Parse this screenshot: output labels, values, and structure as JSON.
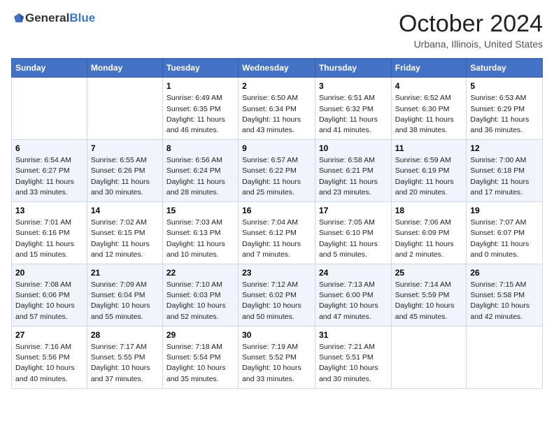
{
  "header": {
    "logo_general": "General",
    "logo_blue": "Blue",
    "month_title": "October 2024",
    "location": "Urbana, Illinois, United States"
  },
  "weekdays": [
    "Sunday",
    "Monday",
    "Tuesday",
    "Wednesday",
    "Thursday",
    "Friday",
    "Saturday"
  ],
  "weeks": [
    [
      {
        "day": "",
        "content": ""
      },
      {
        "day": "",
        "content": ""
      },
      {
        "day": "1",
        "content": "Sunrise: 6:49 AM\nSunset: 6:35 PM\nDaylight: 11 hours and 46 minutes."
      },
      {
        "day": "2",
        "content": "Sunrise: 6:50 AM\nSunset: 6:34 PM\nDaylight: 11 hours and 43 minutes."
      },
      {
        "day": "3",
        "content": "Sunrise: 6:51 AM\nSunset: 6:32 PM\nDaylight: 11 hours and 41 minutes."
      },
      {
        "day": "4",
        "content": "Sunrise: 6:52 AM\nSunset: 6:30 PM\nDaylight: 11 hours and 38 minutes."
      },
      {
        "day": "5",
        "content": "Sunrise: 6:53 AM\nSunset: 6:29 PM\nDaylight: 11 hours and 36 minutes."
      }
    ],
    [
      {
        "day": "6",
        "content": "Sunrise: 6:54 AM\nSunset: 6:27 PM\nDaylight: 11 hours and 33 minutes."
      },
      {
        "day": "7",
        "content": "Sunrise: 6:55 AM\nSunset: 6:26 PM\nDaylight: 11 hours and 30 minutes."
      },
      {
        "day": "8",
        "content": "Sunrise: 6:56 AM\nSunset: 6:24 PM\nDaylight: 11 hours and 28 minutes."
      },
      {
        "day": "9",
        "content": "Sunrise: 6:57 AM\nSunset: 6:22 PM\nDaylight: 11 hours and 25 minutes."
      },
      {
        "day": "10",
        "content": "Sunrise: 6:58 AM\nSunset: 6:21 PM\nDaylight: 11 hours and 23 minutes."
      },
      {
        "day": "11",
        "content": "Sunrise: 6:59 AM\nSunset: 6:19 PM\nDaylight: 11 hours and 20 minutes."
      },
      {
        "day": "12",
        "content": "Sunrise: 7:00 AM\nSunset: 6:18 PM\nDaylight: 11 hours and 17 minutes."
      }
    ],
    [
      {
        "day": "13",
        "content": "Sunrise: 7:01 AM\nSunset: 6:16 PM\nDaylight: 11 hours and 15 minutes."
      },
      {
        "day": "14",
        "content": "Sunrise: 7:02 AM\nSunset: 6:15 PM\nDaylight: 11 hours and 12 minutes."
      },
      {
        "day": "15",
        "content": "Sunrise: 7:03 AM\nSunset: 6:13 PM\nDaylight: 11 hours and 10 minutes."
      },
      {
        "day": "16",
        "content": "Sunrise: 7:04 AM\nSunset: 6:12 PM\nDaylight: 11 hours and 7 minutes."
      },
      {
        "day": "17",
        "content": "Sunrise: 7:05 AM\nSunset: 6:10 PM\nDaylight: 11 hours and 5 minutes."
      },
      {
        "day": "18",
        "content": "Sunrise: 7:06 AM\nSunset: 6:09 PM\nDaylight: 11 hours and 2 minutes."
      },
      {
        "day": "19",
        "content": "Sunrise: 7:07 AM\nSunset: 6:07 PM\nDaylight: 11 hours and 0 minutes."
      }
    ],
    [
      {
        "day": "20",
        "content": "Sunrise: 7:08 AM\nSunset: 6:06 PM\nDaylight: 10 hours and 57 minutes."
      },
      {
        "day": "21",
        "content": "Sunrise: 7:09 AM\nSunset: 6:04 PM\nDaylight: 10 hours and 55 minutes."
      },
      {
        "day": "22",
        "content": "Sunrise: 7:10 AM\nSunset: 6:03 PM\nDaylight: 10 hours and 52 minutes."
      },
      {
        "day": "23",
        "content": "Sunrise: 7:12 AM\nSunset: 6:02 PM\nDaylight: 10 hours and 50 minutes."
      },
      {
        "day": "24",
        "content": "Sunrise: 7:13 AM\nSunset: 6:00 PM\nDaylight: 10 hours and 47 minutes."
      },
      {
        "day": "25",
        "content": "Sunrise: 7:14 AM\nSunset: 5:59 PM\nDaylight: 10 hours and 45 minutes."
      },
      {
        "day": "26",
        "content": "Sunrise: 7:15 AM\nSunset: 5:58 PM\nDaylight: 10 hours and 42 minutes."
      }
    ],
    [
      {
        "day": "27",
        "content": "Sunrise: 7:16 AM\nSunset: 5:56 PM\nDaylight: 10 hours and 40 minutes."
      },
      {
        "day": "28",
        "content": "Sunrise: 7:17 AM\nSunset: 5:55 PM\nDaylight: 10 hours and 37 minutes."
      },
      {
        "day": "29",
        "content": "Sunrise: 7:18 AM\nSunset: 5:54 PM\nDaylight: 10 hours and 35 minutes."
      },
      {
        "day": "30",
        "content": "Sunrise: 7:19 AM\nSunset: 5:52 PM\nDaylight: 10 hours and 33 minutes."
      },
      {
        "day": "31",
        "content": "Sunrise: 7:21 AM\nSunset: 5:51 PM\nDaylight: 10 hours and 30 minutes."
      },
      {
        "day": "",
        "content": ""
      },
      {
        "day": "",
        "content": ""
      }
    ]
  ]
}
